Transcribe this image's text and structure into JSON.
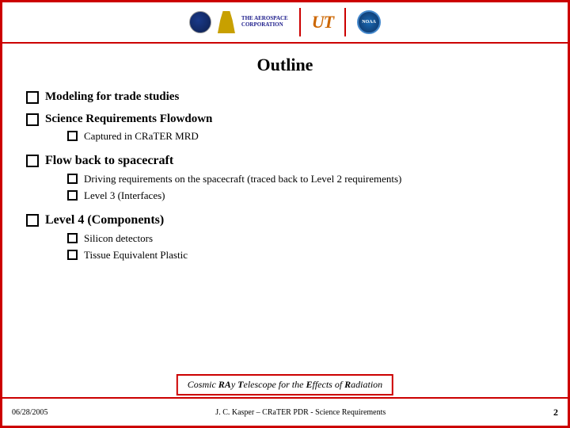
{
  "header": {
    "logos": [
      "aerospace-logo",
      "ut-logo",
      "noaa-logo"
    ]
  },
  "slide": {
    "title": "Outline",
    "items": [
      {
        "id": "item-modeling",
        "text": "Modeling for trade studies",
        "sub": []
      },
      {
        "id": "item-science",
        "text": "Science Requirements Flowdown",
        "sub": [
          {
            "text": "Captured in CRaTER MRD"
          }
        ]
      },
      {
        "id": "item-flow",
        "text": "Flow back to spacecraft",
        "sub": [
          {
            "text": "Driving requirements on the spacecraft (traced back to Level 2 requirements)"
          },
          {
            "text": "Level 3 (Interfaces)"
          }
        ]
      },
      {
        "id": "item-level4",
        "text": "Level 4 (Components)",
        "sub": [
          {
            "text": "Silicon detectors"
          },
          {
            "text": "Tissue Equivalent Plastic"
          }
        ]
      }
    ]
  },
  "footer": {
    "date": "06/28/2005",
    "title": "J. C. Kasper – CRaTER PDR - Science Requirements",
    "page": "2"
  },
  "crater_banner": "Cosmic RAy Telescope for the Effects of Radiation"
}
